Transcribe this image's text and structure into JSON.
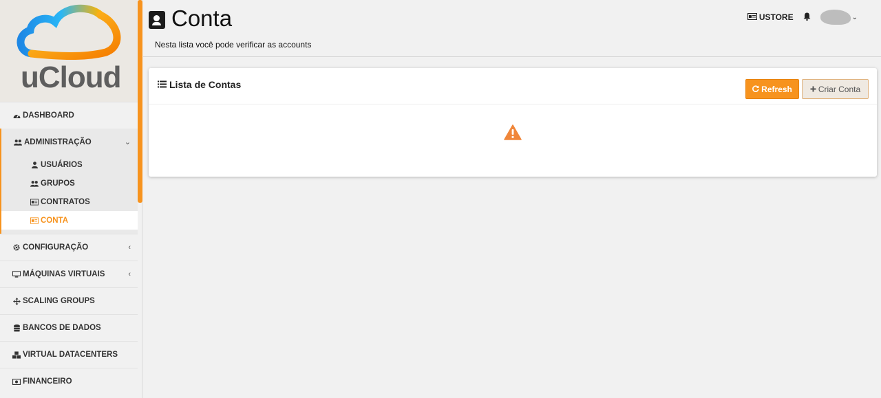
{
  "app": {
    "brand": "uCloud"
  },
  "sidebar": {
    "items": [
      {
        "label": "DASHBOARD",
        "icon": "dashboard-icon"
      },
      {
        "label": "ADMINISTRAÇÃO",
        "icon": "users-icon"
      },
      {
        "label": "CONFIGURAÇÃO",
        "icon": "gear-icon"
      },
      {
        "label": "MÁQUINAS VIRTUAIS",
        "icon": "monitor-icon"
      },
      {
        "label": "SCALING GROUPS",
        "icon": "arrows-icon"
      },
      {
        "label": "BANCOS DE DADOS",
        "icon": "database-icon"
      },
      {
        "label": "VIRTUAL DATACENTERS",
        "icon": "cubes-icon"
      },
      {
        "label": "FINANCEIRO",
        "icon": "money-icon"
      }
    ],
    "admin_sub": [
      {
        "label": "USUÁRIOS",
        "icon": "user-icon"
      },
      {
        "label": "GRUPOS",
        "icon": "users-icon"
      },
      {
        "label": "CONTRATOS",
        "icon": "id-card-icon"
      },
      {
        "label": "CONTA",
        "icon": "id-card-icon",
        "active": true
      }
    ]
  },
  "header": {
    "title": "Conta",
    "subtitle": "Nesta lista você pode verificar as accounts",
    "store": "USTORE"
  },
  "panel": {
    "title": "Lista de Contas",
    "refresh_label": "Refresh",
    "create_label": "Criar Conta"
  },
  "colors": {
    "accent": "#f7931e",
    "warning": "#f0863a"
  }
}
